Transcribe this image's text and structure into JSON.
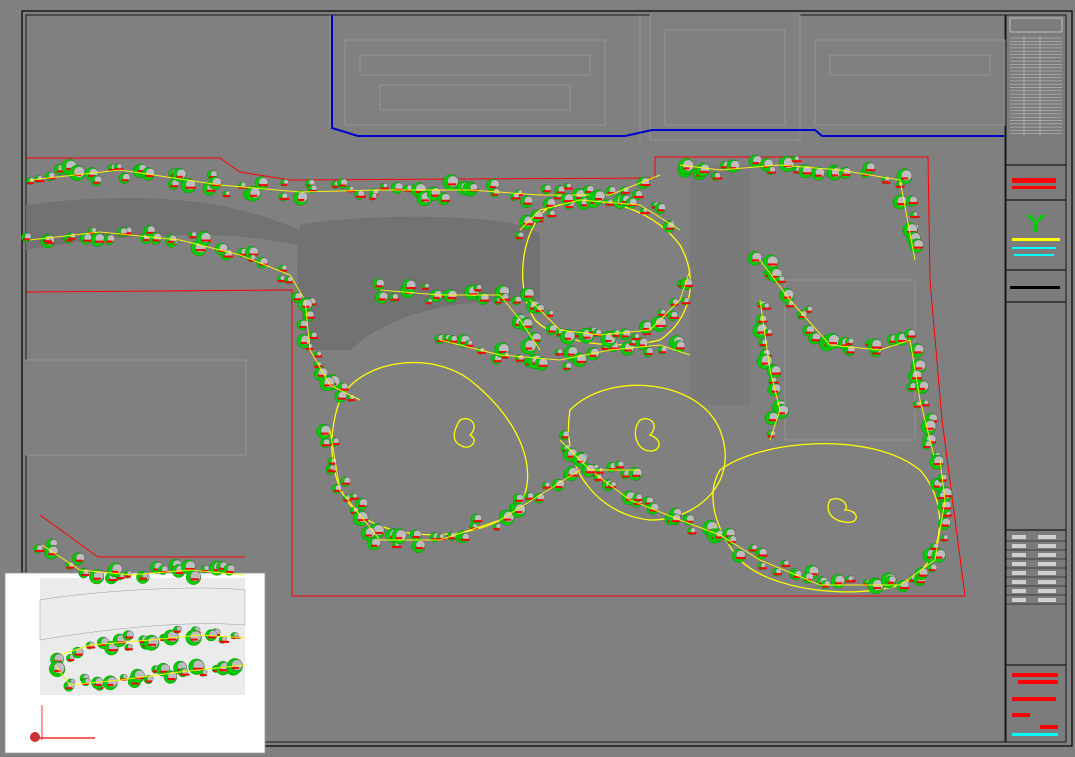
{
  "drawing": {
    "background": "#808080",
    "colors": {
      "frame": "#000000",
      "site_boundary": "#ff0000",
      "road_edge": "#0000cc",
      "planting_outline": "#ffff00",
      "shrub_fill": "#00cc00",
      "tree_symbol": "#ff0000",
      "paving": "#6f6f6f",
      "building_ghost": "#9a9a9a",
      "title_block_accent": "#00ffff",
      "logo": "#00cc00"
    },
    "viewport_background": "#ffffff"
  },
  "title_block": {
    "rows": [
      "",
      "",
      "",
      "",
      "",
      "",
      "",
      ""
    ]
  }
}
